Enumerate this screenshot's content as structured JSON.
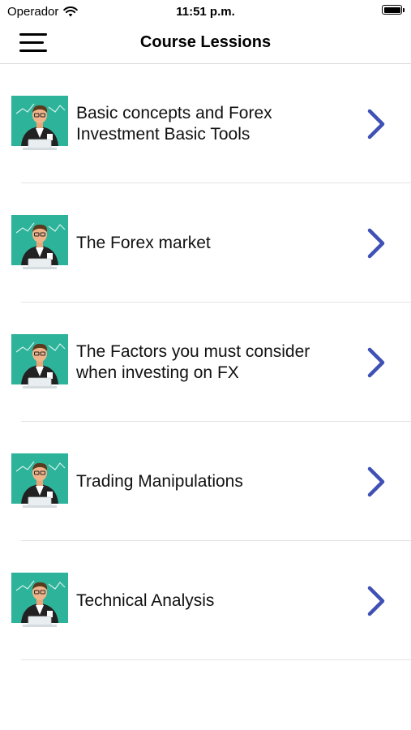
{
  "status_bar": {
    "carrier": "Operador",
    "time": "11:51 p.m.",
    "wifi_icon": "wifi-icon",
    "battery_icon": "battery-icon"
  },
  "nav": {
    "title": "Course Lessions",
    "menu_icon": "hamburger-menu-icon"
  },
  "colors": {
    "accent": "#3f51b5",
    "thumb_bg": "#2cb39a"
  },
  "lessons": [
    {
      "title": "Basic concepts and Forex Investment Basic Tools",
      "thumbnail": "businessman-laptop-thumbnail"
    },
    {
      "title": "The Forex market",
      "thumbnail": "businessman-laptop-thumbnail"
    },
    {
      "title": "The Factors you must consider when investing on FX",
      "thumbnail": "businessman-laptop-thumbnail"
    },
    {
      "title": "Trading Manipulations",
      "thumbnail": "businessman-laptop-thumbnail"
    },
    {
      "title": "Technical Analysis",
      "thumbnail": "businessman-laptop-thumbnail"
    }
  ]
}
